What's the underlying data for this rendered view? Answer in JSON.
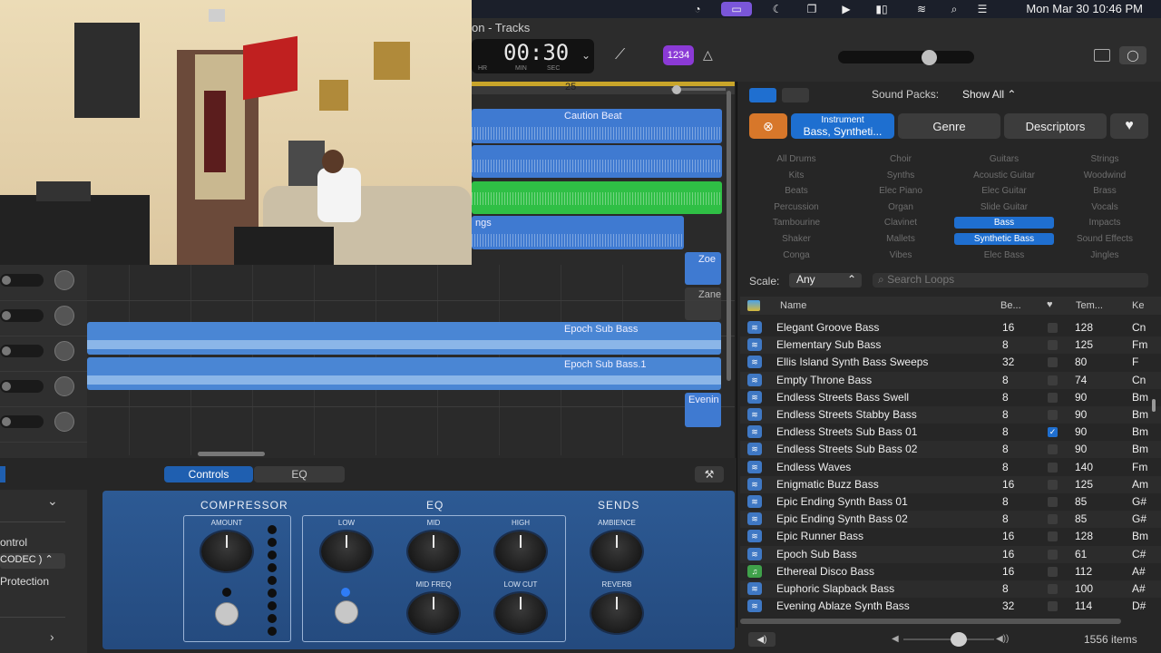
{
  "menubar": {
    "clock": "Mon Mar 30  10:46 PM"
  },
  "toolbar": {
    "title": "on - Tracks",
    "lcd_time": "00:30",
    "lcd_hr": "HR",
    "lcd_min": "MIN",
    "lcd_sec": "SEC",
    "count_in": "1234"
  },
  "ruler": {
    "bar_label": "25"
  },
  "regions": {
    "caution": "Caution Beat",
    "ngs": "ngs",
    "zoe": "Zoe",
    "zane": "Zane",
    "epoch1": "Epoch Sub Bass",
    "epoch2": "Epoch Sub Bass.1",
    "evenin": "Evenin"
  },
  "smart_controls": {
    "tab_controls": "Controls",
    "tab_eq": "EQ",
    "left_control": "ontrol",
    "left_codec": "CODEC )",
    "left_protection": "Protection",
    "compressor": "COMPRESSOR",
    "amount": "AMOUNT",
    "eq": "EQ",
    "low": "LOW",
    "mid": "MID",
    "high": "HIGH",
    "mid_freq": "MID FREQ",
    "low_cut": "LOW CUT",
    "sends": "SENDS",
    "ambience": "AMBIENCE",
    "reverb": "REVERB"
  },
  "browser": {
    "sound_packs_label": "Sound Packs:",
    "sound_packs_value": "Show All",
    "instrument_label": "Instrument",
    "instrument_value": "Bass, Syntheti...",
    "genre": "Genre",
    "descriptors": "Descriptors",
    "keywords": [
      [
        "All Drums",
        "Choir",
        "Guitars",
        "Strings"
      ],
      [
        "Kits",
        "Synths",
        "Acoustic Guitar",
        "Woodwind"
      ],
      [
        "Beats",
        "Elec Piano",
        "Elec Guitar",
        "Brass"
      ],
      [
        "Percussion",
        "Organ",
        "Slide Guitar",
        "Vocals"
      ],
      [
        "Tambourine",
        "Clavinet",
        "Bass",
        "Impacts"
      ],
      [
        "Shaker",
        "Mallets",
        "Synthetic Bass",
        "Sound Effects"
      ],
      [
        "Conga",
        "Vibes",
        "Elec Bass",
        "Jingles"
      ]
    ],
    "scale_label": "Scale:",
    "scale_value": "Any",
    "search_placeholder": "Search Loops",
    "columns": {
      "name": "Name",
      "beats": "Be...",
      "tempo": "Tem...",
      "key": "Ke"
    },
    "rows": [
      {
        "name": "Elegant Groove Bass",
        "beats": "16",
        "fav": false,
        "tempo": "128",
        "key": "Cn",
        "green": false
      },
      {
        "name": "Elementary Sub Bass",
        "beats": "8",
        "fav": false,
        "tempo": "125",
        "key": "Fm",
        "green": false
      },
      {
        "name": "Ellis Island Synth Bass Sweeps",
        "beats": "32",
        "fav": false,
        "tempo": "80",
        "key": "F",
        "green": false
      },
      {
        "name": "Empty Throne Bass",
        "beats": "8",
        "fav": false,
        "tempo": "74",
        "key": "Cn",
        "green": false
      },
      {
        "name": "Endless Streets Bass Swell",
        "beats": "8",
        "fav": false,
        "tempo": "90",
        "key": "Bm",
        "green": false
      },
      {
        "name": "Endless Streets Stabby Bass",
        "beats": "8",
        "fav": false,
        "tempo": "90",
        "key": "Bm",
        "green": false
      },
      {
        "name": "Endless Streets Sub Bass 01",
        "beats": "8",
        "fav": true,
        "tempo": "90",
        "key": "Bm",
        "green": false
      },
      {
        "name": "Endless Streets Sub Bass 02",
        "beats": "8",
        "fav": false,
        "tempo": "90",
        "key": "Bm",
        "green": false
      },
      {
        "name": "Endless Waves",
        "beats": "8",
        "fav": false,
        "tempo": "140",
        "key": "Fm",
        "green": false
      },
      {
        "name": "Enigmatic Buzz Bass",
        "beats": "16",
        "fav": false,
        "tempo": "125",
        "key": "Am",
        "green": false
      },
      {
        "name": "Epic Ending Synth Bass 01",
        "beats": "8",
        "fav": false,
        "tempo": "85",
        "key": "G#",
        "green": false
      },
      {
        "name": "Epic Ending Synth Bass 02",
        "beats": "8",
        "fav": false,
        "tempo": "85",
        "key": "G#",
        "green": false
      },
      {
        "name": "Epic Runner Bass",
        "beats": "16",
        "fav": false,
        "tempo": "128",
        "key": "Bm",
        "green": false
      },
      {
        "name": "Epoch Sub Bass",
        "beats": "16",
        "fav": false,
        "tempo": "61",
        "key": "C#",
        "green": false
      },
      {
        "name": "Ethereal Disco Bass",
        "beats": "16",
        "fav": false,
        "tempo": "112",
        "key": "A#",
        "green": true
      },
      {
        "name": "Euphoric Slapback Bass",
        "beats": "8",
        "fav": false,
        "tempo": "100",
        "key": "A#",
        "green": false
      },
      {
        "name": "Evening Ablaze Synth Bass",
        "beats": "32",
        "fav": false,
        "tempo": "114",
        "key": "D#",
        "green": false
      }
    ],
    "item_count": "1556 items"
  }
}
